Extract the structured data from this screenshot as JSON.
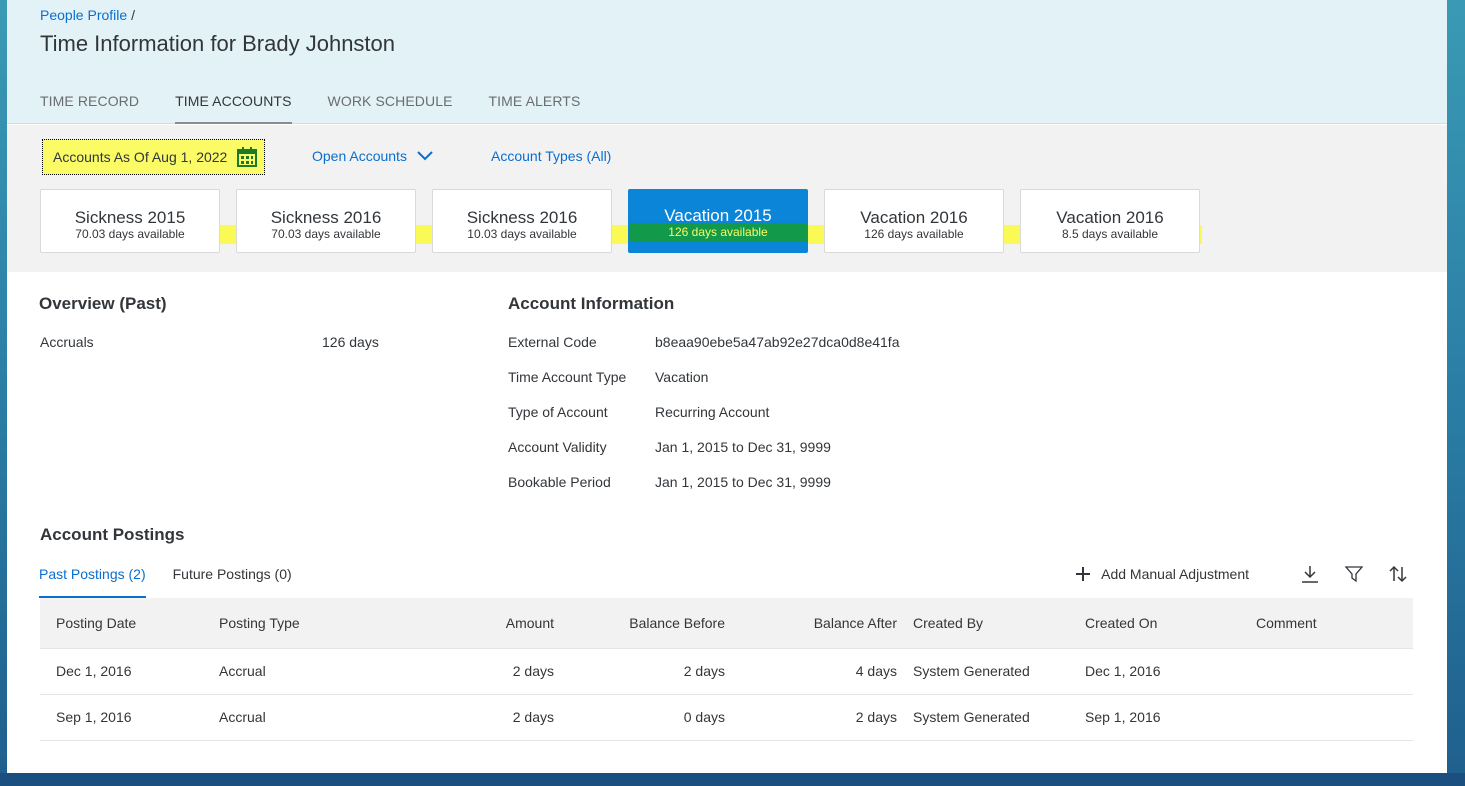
{
  "header": {
    "breadcrumb": "People Profile",
    "breadcrumb_sep": "/",
    "title": "Time Information for Brady Johnston",
    "tabs": [
      {
        "label": "TIME RECORD"
      },
      {
        "label": "TIME ACCOUNTS"
      },
      {
        "label": "WORK SCHEDULE"
      },
      {
        "label": "TIME ALERTS"
      }
    ]
  },
  "filters": {
    "as_of": "Accounts As Of Aug 1, 2022",
    "open_accounts": "Open Accounts",
    "account_types": "Account Types (All)"
  },
  "accounts": [
    {
      "name": "Sickness 2015",
      "available": "70.03 days available"
    },
    {
      "name": "Sickness 2016",
      "available": "70.03 days available"
    },
    {
      "name": "Sickness 2016",
      "available": "10.03 days available"
    },
    {
      "name": "Vacation 2015",
      "available": "126 days available"
    },
    {
      "name": "Vacation 2016",
      "available": "126 days available"
    },
    {
      "name": "Vacation 2016",
      "available": "8.5 days available"
    }
  ],
  "overview": {
    "heading": "Overview (Past)",
    "accruals_label": "Accruals",
    "accruals_value": "126 days"
  },
  "account_info": {
    "heading": "Account Information",
    "rows": [
      {
        "label": "External Code",
        "value": "b8eaa90ebe5a47ab92e27dca0d8e41fa"
      },
      {
        "label": "Time Account Type",
        "value": "Vacation"
      },
      {
        "label": "Type of Account",
        "value": "Recurring Account"
      },
      {
        "label": "Account Validity",
        "value": "Jan 1, 2015 to Dec 31, 9999"
      },
      {
        "label": "Bookable Period",
        "value": "Jan 1, 2015 to Dec 31, 9999"
      }
    ]
  },
  "postings": {
    "heading": "Account Postings",
    "tabs": [
      {
        "label": "Past Postings (2)"
      },
      {
        "label": "Future Postings (0)"
      }
    ],
    "add_label": "Add Manual Adjustment",
    "columns": [
      "Posting Date",
      "Posting Type",
      "Amount",
      "Balance Before",
      "Balance After",
      "Created By",
      "Created On",
      "Comment"
    ],
    "rows": [
      [
        "Dec 1, 2016",
        "Accrual",
        "2 days",
        "2 days",
        "4 days",
        "System Generated",
        "Dec 1, 2016",
        ""
      ],
      [
        "Sep 1, 2016",
        "Accrual",
        "2 days",
        "0 days",
        "2 days",
        "System Generated",
        "Sep 1, 2016",
        ""
      ]
    ]
  },
  "colors": {
    "accent": "#0a6ed1",
    "selected_card": "#0a85d8",
    "highlight": "#fbfb66",
    "selected_highlight": "#12994a"
  }
}
